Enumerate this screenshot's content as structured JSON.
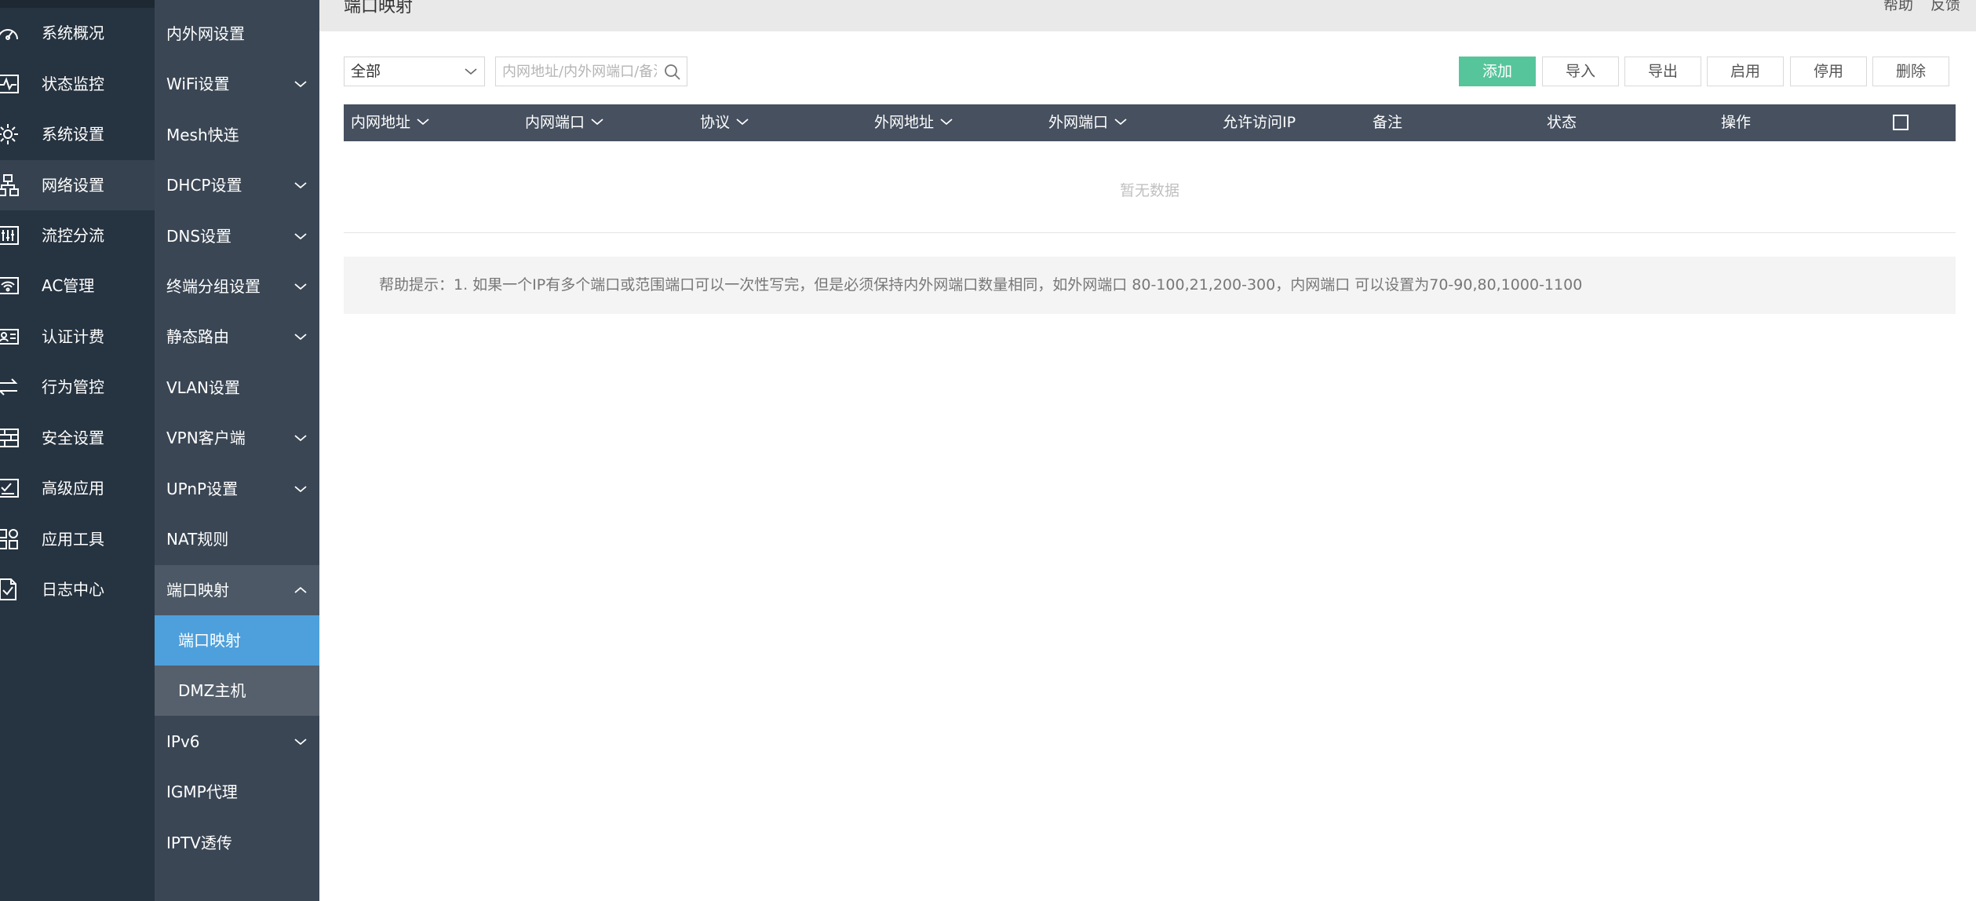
{
  "primary_nav": [
    {
      "label": "系统概况",
      "icon": "dashboard-icon"
    },
    {
      "label": "状态监控",
      "icon": "pulse-icon"
    },
    {
      "label": "系统设置",
      "icon": "gear-icon"
    },
    {
      "label": "网络设置",
      "icon": "network-icon",
      "active": true
    },
    {
      "label": "流控分流",
      "icon": "sliders-icon"
    },
    {
      "label": "AC管理",
      "icon": "wifi-icon"
    },
    {
      "label": "认证计费",
      "icon": "id-card-icon"
    },
    {
      "label": "行为管控",
      "icon": "arrows-icon"
    },
    {
      "label": "安全设置",
      "icon": "firewall-icon"
    },
    {
      "label": "高级应用",
      "icon": "checklist-icon"
    },
    {
      "label": "应用工具",
      "icon": "apps-icon"
    },
    {
      "label": "日志中心",
      "icon": "log-icon"
    }
  ],
  "secondary_nav": [
    {
      "label": "内外网设置"
    },
    {
      "label": "WiFi设置",
      "chevron": "down"
    },
    {
      "label": "Mesh快连"
    },
    {
      "label": "DHCP设置",
      "chevron": "down"
    },
    {
      "label": "DNS设置",
      "chevron": "down"
    },
    {
      "label": "终端分组设置",
      "chevron": "down"
    },
    {
      "label": "静态路由",
      "chevron": "down"
    },
    {
      "label": "VLAN设置"
    },
    {
      "label": "VPN客户端",
      "chevron": "down"
    },
    {
      "label": "UPnP设置",
      "chevron": "down"
    },
    {
      "label": "NAT规则"
    },
    {
      "label": "端口映射",
      "chevron": "up",
      "open": true
    },
    {
      "label": "端口映射",
      "sub": true,
      "selected": true
    },
    {
      "label": "DMZ主机",
      "sub": true
    },
    {
      "label": "IPv6",
      "chevron": "down"
    },
    {
      "label": "IGMP代理"
    },
    {
      "label": "IPTV透传"
    }
  ],
  "header": {
    "title": "端口映射",
    "help": "帮助",
    "feedback": "反馈"
  },
  "toolbar": {
    "filter_value": "全部",
    "search_placeholder": "内网地址/内外网端口/备注",
    "add": "添加",
    "import": "导入",
    "export": "导出",
    "enable": "启用",
    "disable": "停用",
    "delete": "删除"
  },
  "table": {
    "columns": [
      "内网地址",
      "内网端口",
      "协议",
      "外网地址",
      "外网端口",
      "允许访问IP",
      "备注",
      "状态",
      "操作"
    ],
    "empty": "暂无数据"
  },
  "help_tip": "帮助提示：1. 如果一个IP有多个端口或范围端口可以一次性写完，但是必须保持内外网端口数量相同，如外网端口 80-100,21,200-300，内网端口 可以设置为70-90,80,1000-1100",
  "colors": {
    "sidebar_primary": "#263340",
    "sidebar_secondary": "#3a4654",
    "selected": "#4ea0dc",
    "add_button": "#57c59b",
    "table_header": "#46505f"
  }
}
